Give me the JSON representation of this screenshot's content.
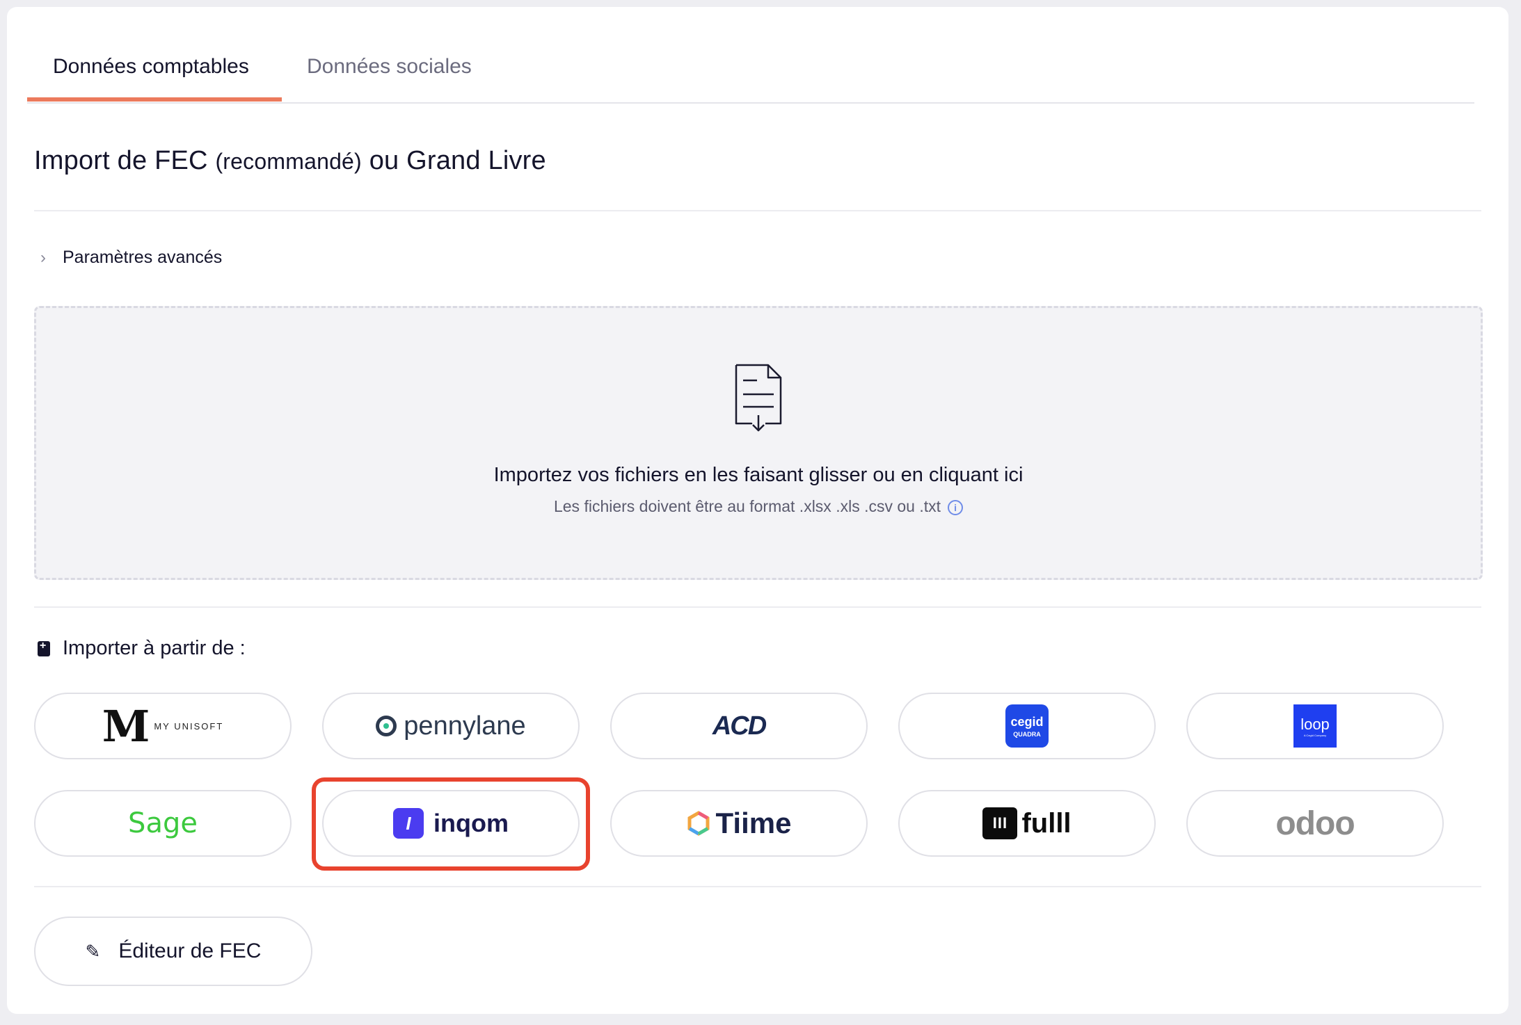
{
  "tabs": [
    {
      "label": "Données comptables",
      "active": true
    },
    {
      "label": "Données sociales",
      "active": false
    }
  ],
  "section": {
    "title_part1": "Import de FEC",
    "title_part2": "(recommandé)",
    "title_part3": "ou Grand Livre"
  },
  "advanced": {
    "label": "Paramètres avancés"
  },
  "dropzone": {
    "main": "Importez vos fichiers en les faisant glisser ou en cliquant ici",
    "sub": "Les fichiers doivent être au format .xlsx .xls .csv ou .txt"
  },
  "import_from": {
    "label": "Importer à partir de :"
  },
  "sources": {
    "myunisoft": {
      "mark": "M",
      "text": "MY UNISOFT"
    },
    "pennylane": {
      "text": "pennylane"
    },
    "acd": {
      "text": "ACD"
    },
    "cegid": {
      "text": "cegid",
      "sub": "QUADRA"
    },
    "loop": {
      "text": "loop",
      "sub": "A Cegid Company"
    },
    "sage": {
      "text": "Sage"
    },
    "inqom": {
      "text": "inqom",
      "mark": "I"
    },
    "tiime": {
      "text": "Tiime"
    },
    "fulll": {
      "text": "fulll",
      "mark": "III"
    },
    "odoo": {
      "text": "odoo"
    }
  },
  "editor": {
    "label": "Éditeur de FEC"
  },
  "colors": {
    "accent": "#ec7a5c",
    "highlight": "#e8432e"
  }
}
